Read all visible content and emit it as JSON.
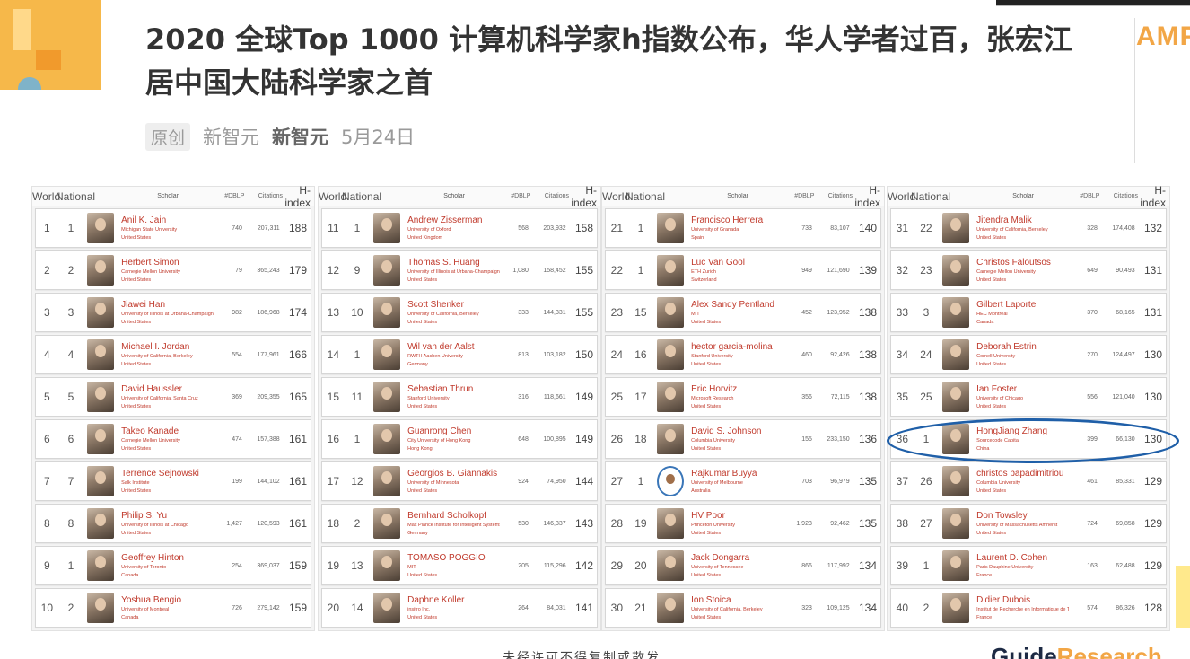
{
  "article": {
    "title": "2020 全球Top 1000 计算机科学家h指数公布，华人学者过百，张宏江居中国大陆科学家之首",
    "badge": "原创",
    "source": "新智元",
    "author": "新智元",
    "date": "5月24日"
  },
  "side_brand": "AMP",
  "bottom_text": "未经许可不得复制或散发",
  "bottom_brand": {
    "part1": "Guide",
    "part2": "Research"
  },
  "table_headers": {
    "world": "World",
    "national": "National",
    "scholar": "Scholar",
    "dblp": "#DBLP",
    "citations": "Citations",
    "hindex": "H-index"
  },
  "panels": [
    {
      "rows": [
        {
          "world": "1",
          "national": "1",
          "name": "Anil K. Jain",
          "institution": "Michigan State University",
          "country": "United States",
          "dblp": "740",
          "citations": "207,311",
          "hindex": "188"
        },
        {
          "world": "2",
          "national": "2",
          "name": "Herbert Simon",
          "institution": "Carnegie Mellon University",
          "country": "United States",
          "dblp": "79",
          "citations": "365,243",
          "hindex": "179"
        },
        {
          "world": "3",
          "national": "3",
          "name": "Jiawei Han",
          "institution": "University of Illinois at Urbana-Champaign",
          "country": "United States",
          "dblp": "982",
          "citations": "186,968",
          "hindex": "174"
        },
        {
          "world": "4",
          "national": "4",
          "name": "Michael I. Jordan",
          "institution": "University of California, Berkeley",
          "country": "United States",
          "dblp": "554",
          "citations": "177,961",
          "hindex": "166"
        },
        {
          "world": "5",
          "national": "5",
          "name": "David Haussler",
          "institution": "University of California, Santa Cruz",
          "country": "United States",
          "dblp": "369",
          "citations": "209,355",
          "hindex": "165"
        },
        {
          "world": "6",
          "national": "6",
          "name": "Takeo Kanade",
          "institution": "Carnegie Mellon University",
          "country": "United States",
          "dblp": "474",
          "citations": "157,388",
          "hindex": "161"
        },
        {
          "world": "7",
          "national": "7",
          "name": "Terrence Sejnowski",
          "institution": "Salk Institute",
          "country": "United States",
          "dblp": "199",
          "citations": "144,102",
          "hindex": "161"
        },
        {
          "world": "8",
          "national": "8",
          "name": "Philip S. Yu",
          "institution": "University of Illinois at Chicago",
          "country": "United States",
          "dblp": "1,427",
          "citations": "120,593",
          "hindex": "161"
        },
        {
          "world": "9",
          "national": "1",
          "name": "Geoffrey Hinton",
          "institution": "University of Toronto",
          "country": "Canada",
          "dblp": "254",
          "citations": "369,037",
          "hindex": "159"
        },
        {
          "world": "10",
          "national": "2",
          "name": "Yoshua Bengio",
          "institution": "University of Montreal",
          "country": "Canada",
          "dblp": "726",
          "citations": "279,142",
          "hindex": "159"
        }
      ]
    },
    {
      "rows": [
        {
          "world": "11",
          "national": "1",
          "name": "Andrew Zisserman",
          "institution": "University of Oxford",
          "country": "United Kingdom",
          "dblp": "568",
          "citations": "203,932",
          "hindex": "158"
        },
        {
          "world": "12",
          "national": "9",
          "name": "Thomas S. Huang",
          "institution": "University of Illinois at Urbana-Champaign",
          "country": "United States",
          "dblp": "1,080",
          "citations": "158,452",
          "hindex": "155"
        },
        {
          "world": "13",
          "national": "10",
          "name": "Scott Shenker",
          "institution": "University of California, Berkeley",
          "country": "United States",
          "dblp": "333",
          "citations": "144,331",
          "hindex": "155"
        },
        {
          "world": "14",
          "national": "1",
          "name": "Wil van der Aalst",
          "institution": "RWTH Aachen University",
          "country": "Germany",
          "dblp": "813",
          "citations": "103,182",
          "hindex": "150"
        },
        {
          "world": "15",
          "national": "11",
          "name": "Sebastian Thrun",
          "institution": "Stanford University",
          "country": "United States",
          "dblp": "316",
          "citations": "118,661",
          "hindex": "149"
        },
        {
          "world": "16",
          "national": "1",
          "name": "Guanrong Chen",
          "institution": "City University of Hong Kong",
          "country": "Hong Kong",
          "dblp": "648",
          "citations": "100,895",
          "hindex": "149"
        },
        {
          "world": "17",
          "national": "12",
          "name": "Georgios B. Giannakis",
          "institution": "University of Minnesota",
          "country": "United States",
          "dblp": "924",
          "citations": "74,950",
          "hindex": "144"
        },
        {
          "world": "18",
          "national": "2",
          "name": "Bernhard Scholkopf",
          "institution": "Max Planck Institute for Intelligent Systems",
          "country": "Germany",
          "dblp": "530",
          "citations": "146,337",
          "hindex": "143"
        },
        {
          "world": "19",
          "national": "13",
          "name": "TOMASO POGGIO",
          "institution": "MIT",
          "country": "United States",
          "dblp": "205",
          "citations": "115,296",
          "hindex": "142"
        },
        {
          "world": "20",
          "national": "14",
          "name": "Daphne Koller",
          "institution": "insitro Inc.",
          "country": "United States",
          "dblp": "264",
          "citations": "84,031",
          "hindex": "141"
        }
      ]
    },
    {
      "rows": [
        {
          "world": "21",
          "national": "1",
          "name": "Francisco Herrera",
          "institution": "University of Granada",
          "country": "Spain",
          "dblp": "733",
          "citations": "83,107",
          "hindex": "140"
        },
        {
          "world": "22",
          "national": "1",
          "name": "Luc Van Gool",
          "institution": "ETH Zurich",
          "country": "Switzerland",
          "dblp": "949",
          "citations": "121,690",
          "hindex": "139"
        },
        {
          "world": "23",
          "national": "15",
          "name": "Alex Sandy Pentland",
          "institution": "MIT",
          "country": "United States",
          "dblp": "452",
          "citations": "123,952",
          "hindex": "138"
        },
        {
          "world": "24",
          "national": "16",
          "name": "hector garcia-molina",
          "institution": "Stanford University",
          "country": "United States",
          "dblp": "460",
          "citations": "92,426",
          "hindex": "138"
        },
        {
          "world": "25",
          "national": "17",
          "name": "Eric Horvitz",
          "institution": "Microsoft Research",
          "country": "United States",
          "dblp": "356",
          "citations": "72,115",
          "hindex": "138"
        },
        {
          "world": "26",
          "national": "18",
          "name": "David S. Johnson",
          "institution": "Columbia University",
          "country": "United States",
          "dblp": "155",
          "citations": "233,150",
          "hindex": "136"
        },
        {
          "world": "27",
          "national": "1",
          "name": "Rajkumar Buyya",
          "institution": "University of Melbourne",
          "country": "Australia",
          "dblp": "703",
          "citations": "96,979",
          "hindex": "135"
        },
        {
          "world": "28",
          "national": "19",
          "name": "HV Poor",
          "institution": "Princeton University",
          "country": "United States",
          "dblp": "1,923",
          "citations": "92,462",
          "hindex": "135"
        },
        {
          "world": "29",
          "national": "20",
          "name": "Jack Dongarra",
          "institution": "University of Tennessee",
          "country": "United States",
          "dblp": "866",
          "citations": "117,992",
          "hindex": "134"
        },
        {
          "world": "30",
          "national": "21",
          "name": "Ion Stoica",
          "institution": "University of California, Berkeley",
          "country": "United States",
          "dblp": "323",
          "citations": "109,125",
          "hindex": "134"
        }
      ]
    },
    {
      "rows": [
        {
          "world": "31",
          "national": "22",
          "name": "Jitendra Malik",
          "institution": "University of California, Berkeley",
          "country": "United States",
          "dblp": "328",
          "citations": "174,408",
          "hindex": "132"
        },
        {
          "world": "32",
          "national": "23",
          "name": "Christos Faloutsos",
          "institution": "Carnegie Mellon University",
          "country": "United States",
          "dblp": "649",
          "citations": "90,493",
          "hindex": "131"
        },
        {
          "world": "33",
          "national": "3",
          "name": "Gilbert Laporte",
          "institution": "HEC Montréal",
          "country": "Canada",
          "dblp": "370",
          "citations": "68,165",
          "hindex": "131"
        },
        {
          "world": "34",
          "national": "24",
          "name": "Deborah Estrin",
          "institution": "Cornell University",
          "country": "United States",
          "dblp": "270",
          "citations": "124,497",
          "hindex": "130"
        },
        {
          "world": "35",
          "national": "25",
          "name": "Ian Foster",
          "institution": "University of Chicago",
          "country": "United States",
          "dblp": "556",
          "citations": "121,040",
          "hindex": "130"
        },
        {
          "world": "36",
          "national": "1",
          "name": "HongJiang Zhang",
          "institution": "Sourcecode Capital",
          "country": "China",
          "dblp": "399",
          "citations": "66,130",
          "hindex": "130"
        },
        {
          "world": "37",
          "national": "26",
          "name": "christos papadimitriou",
          "institution": "Columbia University",
          "country": "United States",
          "dblp": "461",
          "citations": "85,331",
          "hindex": "129"
        },
        {
          "world": "38",
          "national": "27",
          "name": "Don Towsley",
          "institution": "University of Massachusetts Amherst",
          "country": "United States",
          "dblp": "724",
          "citations": "69,858",
          "hindex": "129"
        },
        {
          "world": "39",
          "national": "1",
          "name": "Laurent D. Cohen",
          "institution": "Paris Dauphine University",
          "country": "France",
          "dblp": "163",
          "citations": "62,488",
          "hindex": "129"
        },
        {
          "world": "40",
          "national": "2",
          "name": "Didier Dubois",
          "institution": "Institut de Recherche en Informatique de Toulouse",
          "country": "France",
          "dblp": "574",
          "citations": "86,326",
          "hindex": "128"
        }
      ]
    }
  ]
}
